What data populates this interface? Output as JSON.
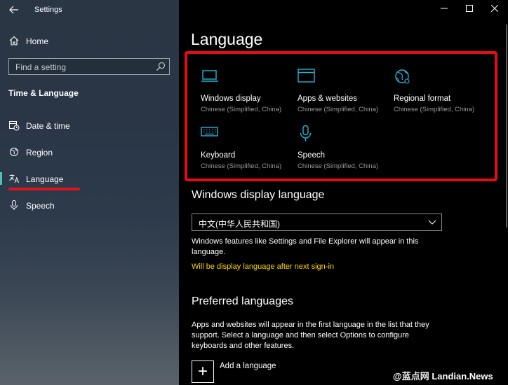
{
  "app": {
    "title": "Settings"
  },
  "sidebar": {
    "home_label": "Home",
    "search_placeholder": "Find a setting",
    "section_title": "Time & Language",
    "items": [
      {
        "label": "Date & time",
        "icon": "date-time-icon"
      },
      {
        "label": "Region",
        "icon": "region-icon"
      },
      {
        "label": "Language",
        "icon": "language-icon",
        "active": true
      },
      {
        "label": "Speech",
        "icon": "microphone-icon"
      }
    ]
  },
  "main": {
    "title": "Language",
    "tiles": [
      {
        "title": "Windows display",
        "subtitle": "Chinese (Simplified, China)",
        "icon": "monitor-icon"
      },
      {
        "title": "Apps & websites",
        "subtitle": "Chinese (Simplified, China)",
        "icon": "browser-window-icon"
      },
      {
        "title": "Regional format",
        "subtitle": "Chinese (Simplified, China)",
        "icon": "globe-icon"
      },
      {
        "title": "Keyboard",
        "subtitle": "Chinese (Simplified, China)",
        "icon": "keyboard-icon"
      },
      {
        "title": "Speech",
        "subtitle": "Chinese (Simplified, China)",
        "icon": "microphone-icon"
      }
    ],
    "display_language": {
      "heading": "Windows display language",
      "selected": "中文(中华人民共和国)",
      "description": "Windows features like Settings and File Explorer will appear in this language.",
      "notice": "Will be display language after next sign-in"
    },
    "preferred": {
      "heading": "Preferred languages",
      "description": "Apps and websites will appear in the first language in the list that they support. Select a language and then select Options to configure keyboards and other features.",
      "add_label": "Add a language"
    }
  },
  "watermark": {
    "at": "@",
    "cn": "蓝点网",
    "en": "Landian.News"
  },
  "colors": {
    "accent": "#4fc3b0",
    "highlight_red": "#e10e15",
    "notice_yellow": "#ffd800",
    "icon_teal": "#2ab4d8"
  }
}
